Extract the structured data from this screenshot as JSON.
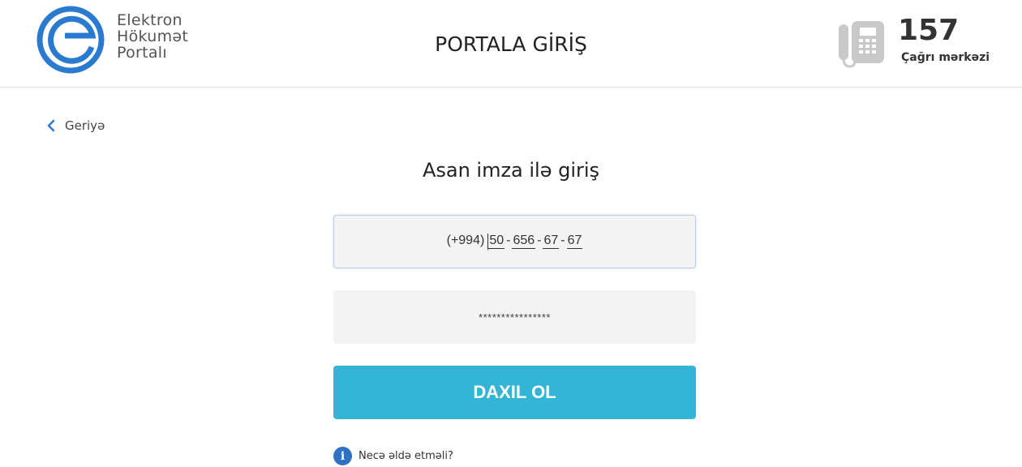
{
  "header": {
    "logo_lines": [
      "Elektron",
      "Hökumət",
      "Portalı"
    ],
    "title": "PORTALA GİRİŞ",
    "call_center": {
      "number": "157",
      "label": "Çağrı mərkəzi",
      "icon": "phone-icon"
    }
  },
  "nav": {
    "back_label": "Geriyə",
    "back_icon": "chevron-left-icon"
  },
  "form": {
    "title": "Asan imza ilə giriş",
    "phone": {
      "prefix": "(+994)",
      "segments": [
        "50",
        "656",
        "67",
        "67"
      ],
      "separator": "-"
    },
    "password_value": "****************",
    "submit_label": "DAXIL OL"
  },
  "help": {
    "label": "Necə əldə etməli?",
    "icon": "info-icon"
  },
  "colors": {
    "accent": "#33b6d6",
    "logo_blue": "#2a7bd0",
    "info_blue": "#2f72c3"
  }
}
